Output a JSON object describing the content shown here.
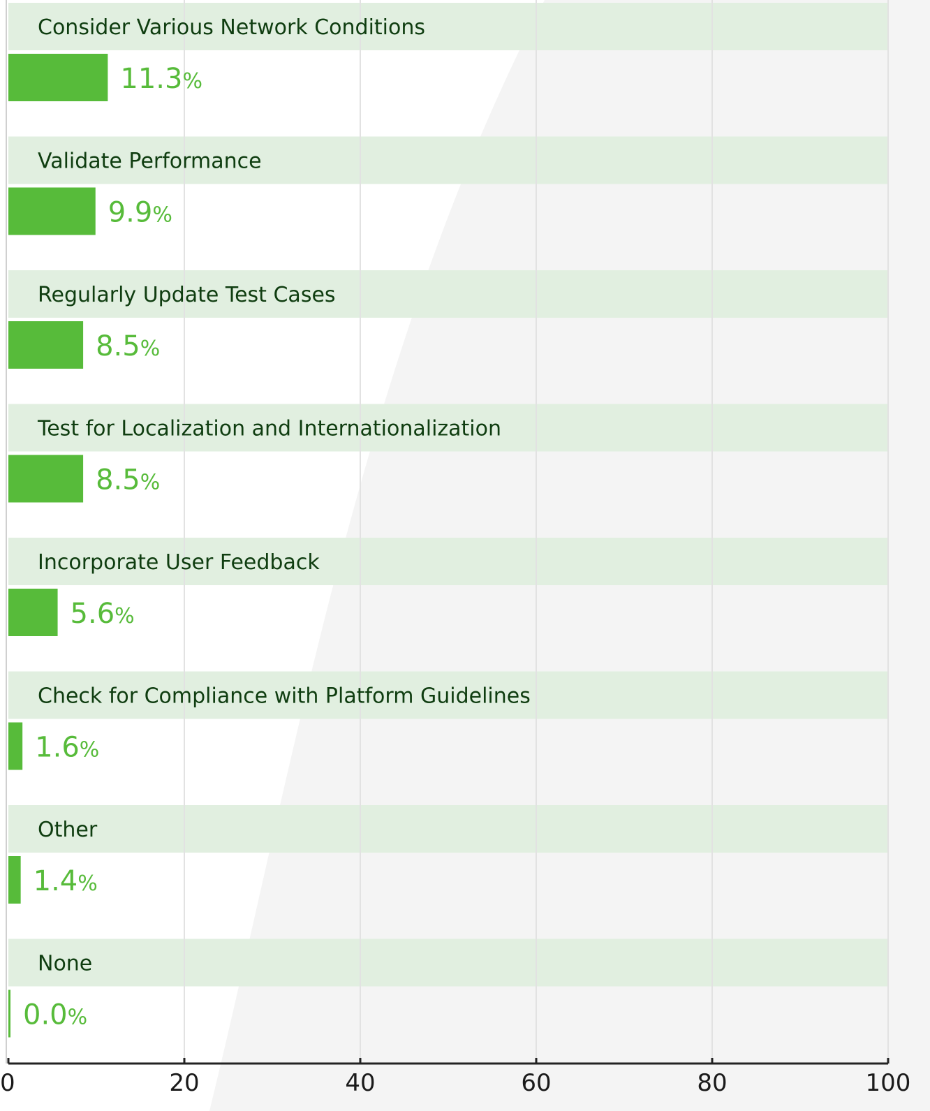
{
  "chart_data": {
    "type": "bar",
    "orientation": "horizontal",
    "categories": [
      "Consider Various Network Conditions",
      "Validate Performance",
      "Regularly Update Test Cases",
      "Test for Localization and Internationalization",
      "Incorporate User Feedback",
      "Check for Compliance with Platform Guidelines",
      "Other",
      "None"
    ],
    "values": [
      11.3,
      9.9,
      8.5,
      8.5,
      5.6,
      1.6,
      1.4,
      0.0
    ],
    "value_labels": [
      "11.3",
      "9.9",
      "8.5",
      "8.5",
      "5.6",
      "1.6",
      "1.4",
      "0.0"
    ],
    "value_suffix": "%",
    "xlim": [
      0,
      100
    ],
    "xticks": [
      0,
      20,
      40,
      60,
      80,
      100
    ],
    "xtick_labels": [
      "0",
      "20",
      "40",
      "60",
      "80",
      "100"
    ],
    "grid": true,
    "legend": "none",
    "colors": {
      "bar": "#57bb3a",
      "label_band": "#e1efe0",
      "label_text": "#0f3d10",
      "value_text": "#57bb3a",
      "grid": "#e2e2e2",
      "axis": "#222222",
      "background_swoosh": "#f4f4f4"
    }
  }
}
